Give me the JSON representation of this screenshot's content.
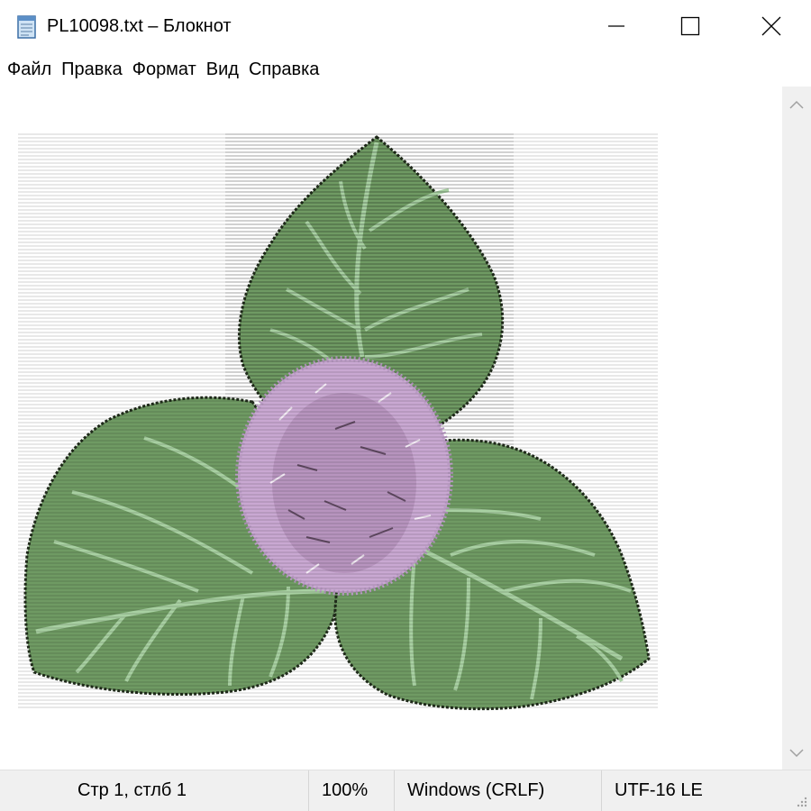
{
  "window": {
    "title": "PL10098.txt – Блокнот",
    "icon": "notepad-icon",
    "controls": [
      "minimize-icon",
      "maximize-icon",
      "close-icon"
    ]
  },
  "menu": {
    "items": [
      "Файл",
      "Правка",
      "Формат",
      "Вид",
      "Справка"
    ]
  },
  "editor": {
    "content_description_icon": "ascii-art-flower-image",
    "colors": {
      "leaf": "#6f9a63",
      "leaf_vein": "#a8d0a2",
      "leaf_edge": "#1f2a1a",
      "flower": "#c9a8d2",
      "flower_dark": "#3a2a3a"
    }
  },
  "status": {
    "position": "Стр 1, стлб 1",
    "zoom": "100%",
    "line_ending": "Windows (CRLF)",
    "encoding": "UTF-16 LE"
  }
}
